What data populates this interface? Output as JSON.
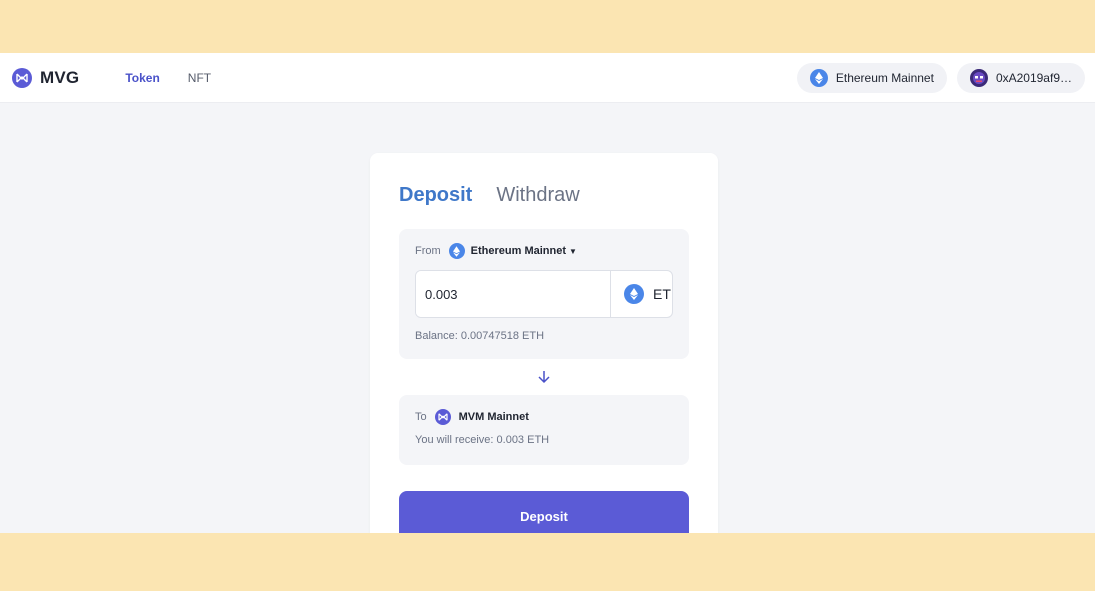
{
  "brand": {
    "name": "MVG",
    "icon": "mvg-logo-icon"
  },
  "nav": {
    "items": [
      {
        "label": "Token",
        "active": true
      },
      {
        "label": "NFT",
        "active": false
      }
    ]
  },
  "header": {
    "network": {
      "label": "Ethereum Mainnet",
      "icon": "ethereum-icon"
    },
    "account": {
      "address": "0xA2019af9…",
      "icon": "avatar-icon"
    }
  },
  "card": {
    "tabs": [
      {
        "label": "Deposit",
        "active": true
      },
      {
        "label": "Withdraw",
        "active": false
      }
    ],
    "from": {
      "label": "From",
      "network": "Ethereum Mainnet",
      "amount": "0.003",
      "token": "ETH",
      "balance": "Balance: 0.00747518 ETH"
    },
    "to": {
      "label": "To",
      "network": "MVM Mainnet",
      "receive": "You will receive: 0.003 ETH"
    },
    "submit_label": "Deposit"
  },
  "colors": {
    "accent": "#5b5bd6",
    "active_tab": "#3f78c9",
    "frame": "#fbe5b2",
    "eth": "#4a86e8"
  }
}
